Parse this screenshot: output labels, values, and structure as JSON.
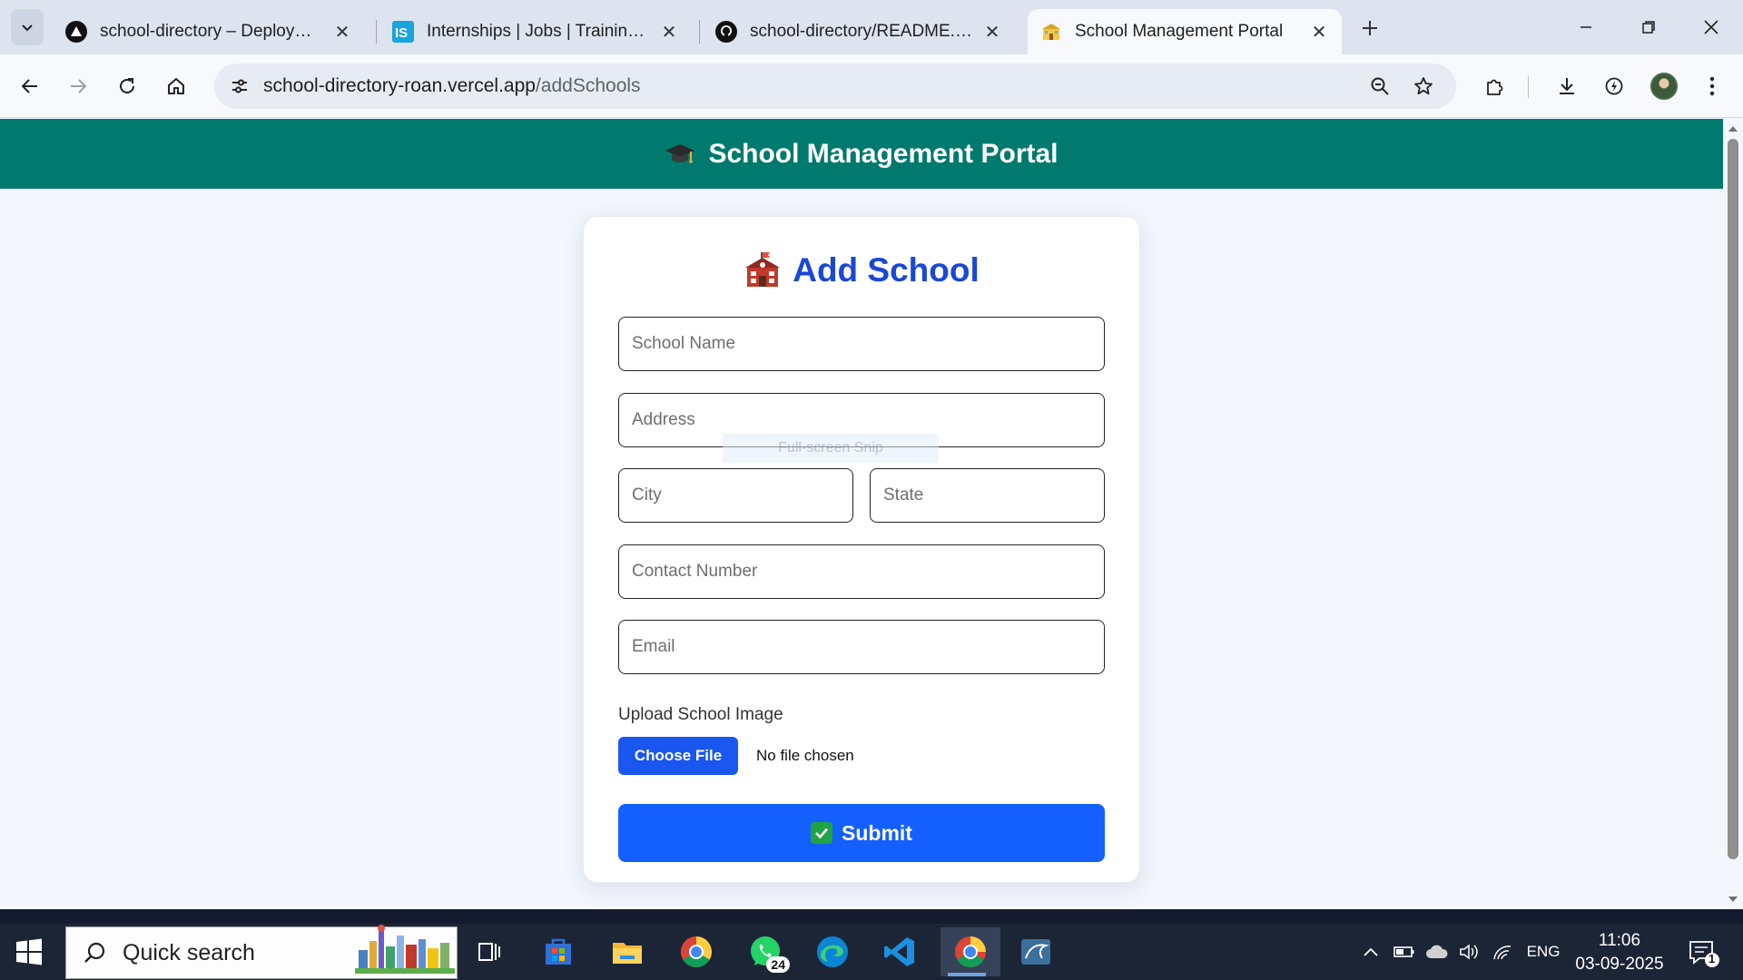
{
  "browser": {
    "tabs": [
      {
        "title": "school-directory – Deployment",
        "favicon": "vercel-icon",
        "active": false
      },
      {
        "title": "Internships | Jobs | Trainings & Placement",
        "favicon": "internshala-icon",
        "active": false
      },
      {
        "title": "school-directory/README.md at main",
        "favicon": "github-icon",
        "active": false
      },
      {
        "title": "School Management Portal",
        "favicon": "school-icon",
        "active": true
      }
    ],
    "url_host": "school-directory-roan.vercel.app",
    "url_path": "/addSchools"
  },
  "header": {
    "icon": "graduation-cap-icon",
    "title": "School Management Portal"
  },
  "form": {
    "title": "Add School",
    "title_icon": "school-building-icon",
    "placeholders": {
      "name": "School Name",
      "address": "Address",
      "city": "City",
      "state": "State",
      "contact": "Contact Number",
      "email": "Email"
    },
    "upload_label": "Upload School Image",
    "choose_file_label": "Choose File",
    "file_status": "No file chosen",
    "submit_label": "Submit"
  },
  "overlay": {
    "snip_text": "Full-screen Snip"
  },
  "taskbar": {
    "search_label": "Quick search",
    "whatsapp_badge": "24",
    "language": "ENG",
    "time": "11:06",
    "date": "03-09-2025",
    "notification_count": "1"
  },
  "colors": {
    "header_bg": "#007a6e",
    "accent_blue": "#1460ff",
    "title_blue": "#1a47d6"
  }
}
